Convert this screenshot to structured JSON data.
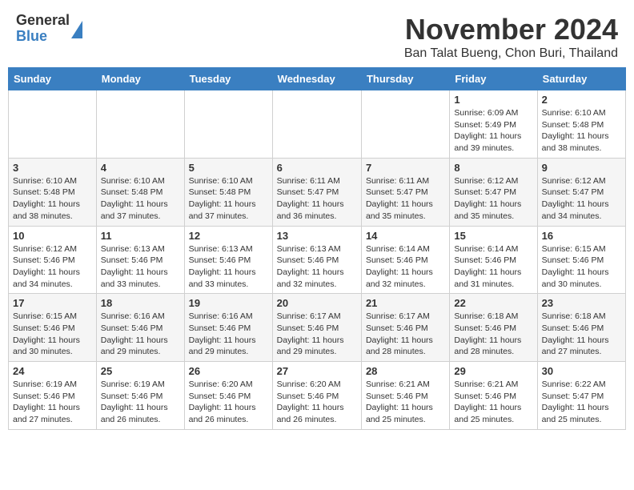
{
  "logo": {
    "general": "General",
    "blue": "Blue"
  },
  "title": "November 2024",
  "location": "Ban Talat Bueng, Chon Buri, Thailand",
  "days_of_week": [
    "Sunday",
    "Monday",
    "Tuesday",
    "Wednesday",
    "Thursday",
    "Friday",
    "Saturday"
  ],
  "weeks": [
    [
      {
        "day": "",
        "info": ""
      },
      {
        "day": "",
        "info": ""
      },
      {
        "day": "",
        "info": ""
      },
      {
        "day": "",
        "info": ""
      },
      {
        "day": "",
        "info": ""
      },
      {
        "day": "1",
        "info": "Sunrise: 6:09 AM\nSunset: 5:49 PM\nDaylight: 11 hours and 39 minutes."
      },
      {
        "day": "2",
        "info": "Sunrise: 6:10 AM\nSunset: 5:48 PM\nDaylight: 11 hours and 38 minutes."
      }
    ],
    [
      {
        "day": "3",
        "info": "Sunrise: 6:10 AM\nSunset: 5:48 PM\nDaylight: 11 hours and 38 minutes."
      },
      {
        "day": "4",
        "info": "Sunrise: 6:10 AM\nSunset: 5:48 PM\nDaylight: 11 hours and 37 minutes."
      },
      {
        "day": "5",
        "info": "Sunrise: 6:10 AM\nSunset: 5:48 PM\nDaylight: 11 hours and 37 minutes."
      },
      {
        "day": "6",
        "info": "Sunrise: 6:11 AM\nSunset: 5:47 PM\nDaylight: 11 hours and 36 minutes."
      },
      {
        "day": "7",
        "info": "Sunrise: 6:11 AM\nSunset: 5:47 PM\nDaylight: 11 hours and 35 minutes."
      },
      {
        "day": "8",
        "info": "Sunrise: 6:12 AM\nSunset: 5:47 PM\nDaylight: 11 hours and 35 minutes."
      },
      {
        "day": "9",
        "info": "Sunrise: 6:12 AM\nSunset: 5:47 PM\nDaylight: 11 hours and 34 minutes."
      }
    ],
    [
      {
        "day": "10",
        "info": "Sunrise: 6:12 AM\nSunset: 5:46 PM\nDaylight: 11 hours and 34 minutes."
      },
      {
        "day": "11",
        "info": "Sunrise: 6:13 AM\nSunset: 5:46 PM\nDaylight: 11 hours and 33 minutes."
      },
      {
        "day": "12",
        "info": "Sunrise: 6:13 AM\nSunset: 5:46 PM\nDaylight: 11 hours and 33 minutes."
      },
      {
        "day": "13",
        "info": "Sunrise: 6:13 AM\nSunset: 5:46 PM\nDaylight: 11 hours and 32 minutes."
      },
      {
        "day": "14",
        "info": "Sunrise: 6:14 AM\nSunset: 5:46 PM\nDaylight: 11 hours and 32 minutes."
      },
      {
        "day": "15",
        "info": "Sunrise: 6:14 AM\nSunset: 5:46 PM\nDaylight: 11 hours and 31 minutes."
      },
      {
        "day": "16",
        "info": "Sunrise: 6:15 AM\nSunset: 5:46 PM\nDaylight: 11 hours and 30 minutes."
      }
    ],
    [
      {
        "day": "17",
        "info": "Sunrise: 6:15 AM\nSunset: 5:46 PM\nDaylight: 11 hours and 30 minutes."
      },
      {
        "day": "18",
        "info": "Sunrise: 6:16 AM\nSunset: 5:46 PM\nDaylight: 11 hours and 29 minutes."
      },
      {
        "day": "19",
        "info": "Sunrise: 6:16 AM\nSunset: 5:46 PM\nDaylight: 11 hours and 29 minutes."
      },
      {
        "day": "20",
        "info": "Sunrise: 6:17 AM\nSunset: 5:46 PM\nDaylight: 11 hours and 29 minutes."
      },
      {
        "day": "21",
        "info": "Sunrise: 6:17 AM\nSunset: 5:46 PM\nDaylight: 11 hours and 28 minutes."
      },
      {
        "day": "22",
        "info": "Sunrise: 6:18 AM\nSunset: 5:46 PM\nDaylight: 11 hours and 28 minutes."
      },
      {
        "day": "23",
        "info": "Sunrise: 6:18 AM\nSunset: 5:46 PM\nDaylight: 11 hours and 27 minutes."
      }
    ],
    [
      {
        "day": "24",
        "info": "Sunrise: 6:19 AM\nSunset: 5:46 PM\nDaylight: 11 hours and 27 minutes."
      },
      {
        "day": "25",
        "info": "Sunrise: 6:19 AM\nSunset: 5:46 PM\nDaylight: 11 hours and 26 minutes."
      },
      {
        "day": "26",
        "info": "Sunrise: 6:20 AM\nSunset: 5:46 PM\nDaylight: 11 hours and 26 minutes."
      },
      {
        "day": "27",
        "info": "Sunrise: 6:20 AM\nSunset: 5:46 PM\nDaylight: 11 hours and 26 minutes."
      },
      {
        "day": "28",
        "info": "Sunrise: 6:21 AM\nSunset: 5:46 PM\nDaylight: 11 hours and 25 minutes."
      },
      {
        "day": "29",
        "info": "Sunrise: 6:21 AM\nSunset: 5:46 PM\nDaylight: 11 hours and 25 minutes."
      },
      {
        "day": "30",
        "info": "Sunrise: 6:22 AM\nSunset: 5:47 PM\nDaylight: 11 hours and 25 minutes."
      }
    ]
  ]
}
